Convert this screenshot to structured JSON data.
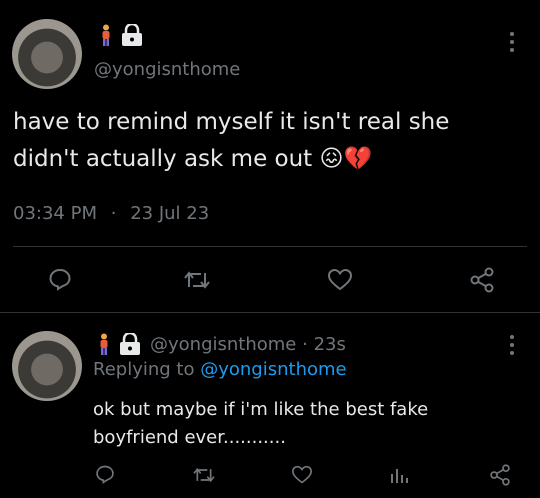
{
  "main_tweet": {
    "handle": "@yongisnthome",
    "text": "have to remind myself it isn't real she didn't actually ask me out",
    "emoji": "😖💔",
    "time": "03:34 PM",
    "separator": "·",
    "date": "23 Jul 23"
  },
  "reply_tweet": {
    "handle": "@yongisnthome",
    "meta_sep": "·",
    "age": "23s",
    "replying_prefix": "Replying to",
    "replying_handle": "@yongisnthome",
    "text": "ok but maybe if i'm like the best fake boyfriend ever..........."
  },
  "icons": {
    "person": "person-icon",
    "lock": "lock-icon",
    "reply": "reply-icon",
    "retweet": "retweet-icon",
    "like": "heart-icon",
    "share": "share-icon",
    "views": "views-icon",
    "more": "more-vert-icon"
  },
  "colors": {
    "background": "#000000",
    "text": "#e7e9ea",
    "muted": "#71767b",
    "link": "#1d9bf0",
    "divider": "#2f3336"
  }
}
